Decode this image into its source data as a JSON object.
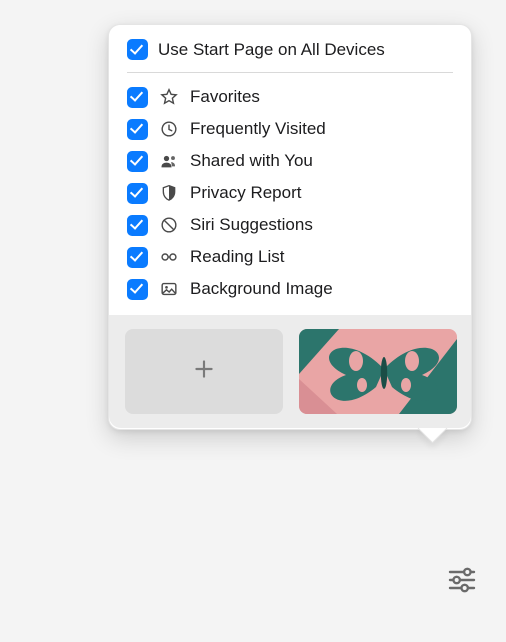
{
  "popover": {
    "header": {
      "label": "Use Start Page on All Devices",
      "checked": true
    },
    "items": [
      {
        "icon": "star-outline-icon",
        "label": "Favorites",
        "checked": true
      },
      {
        "icon": "clock-icon",
        "label": "Frequently Visited",
        "checked": true
      },
      {
        "icon": "people-icon",
        "label": "Shared with You",
        "checked": true
      },
      {
        "icon": "shield-icon",
        "label": "Privacy Report",
        "checked": true
      },
      {
        "icon": "siri-icon",
        "label": "Siri Suggestions",
        "checked": true
      },
      {
        "icon": "glasses-icon",
        "label": "Reading List",
        "checked": true
      },
      {
        "icon": "photo-icon",
        "label": "Background Image",
        "checked": true
      }
    ],
    "thumbnails": {
      "add_label": "Add custom background",
      "preset1_label": "Butterfly background"
    }
  },
  "toolbar": {
    "settings_label": "Customize Start Page"
  }
}
